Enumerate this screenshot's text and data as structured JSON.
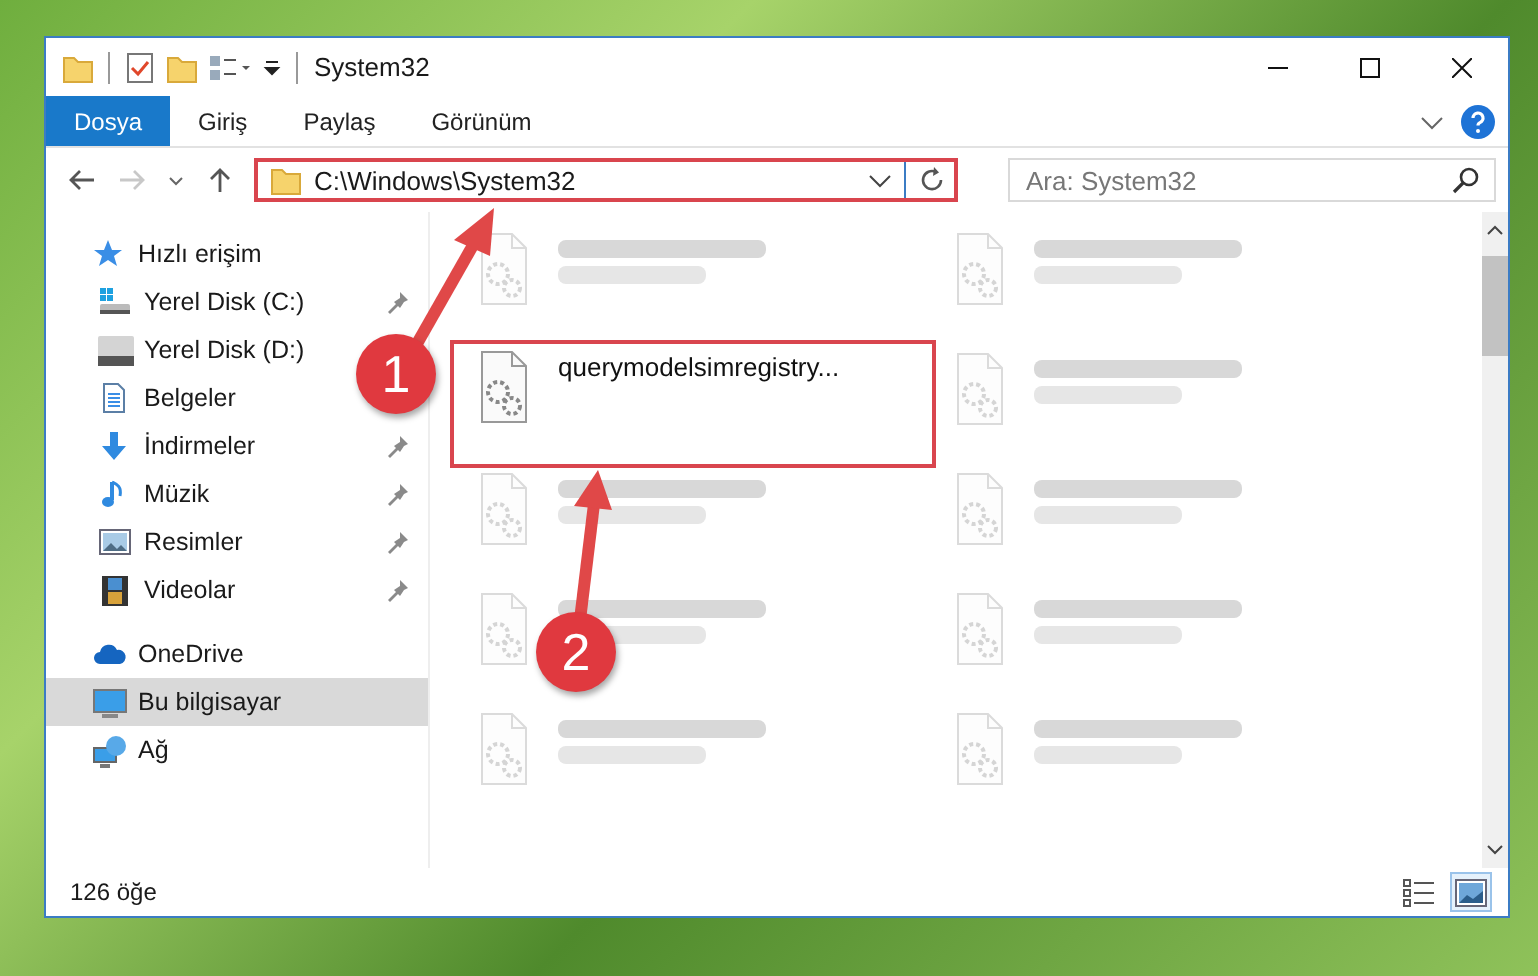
{
  "window": {
    "title": "System32"
  },
  "ribbon_tabs": [
    {
      "label": "Dosya",
      "selected": true
    },
    {
      "label": "Giriş",
      "selected": false
    },
    {
      "label": "Paylaş",
      "selected": false
    },
    {
      "label": "Görünüm",
      "selected": false
    }
  ],
  "nav": {
    "back_disabled": false,
    "forward_disabled": true
  },
  "address": {
    "path": "C:\\Windows\\System32"
  },
  "search": {
    "placeholder": "Ara: System32"
  },
  "sidebar": {
    "items": [
      {
        "label": "Hızlı erişim",
        "kind": "star",
        "selected": false,
        "children": [
          {
            "label": "Yerel Disk (C:)",
            "kind": "drive-win",
            "pinned": true
          },
          {
            "label": "Yerel Disk (D:)",
            "kind": "drive",
            "pinned": false
          },
          {
            "label": "Belgeler",
            "kind": "doc",
            "pinned": false
          },
          {
            "label": "İndirmeler",
            "kind": "download",
            "pinned": true
          },
          {
            "label": "Müzik",
            "kind": "music",
            "pinned": true
          },
          {
            "label": "Resimler",
            "kind": "picture",
            "pinned": true
          },
          {
            "label": "Videolar",
            "kind": "video",
            "pinned": true
          }
        ]
      },
      {
        "label": "OneDrive",
        "kind": "cloud",
        "selected": false
      },
      {
        "label": "Bu bilgisayar",
        "kind": "pc",
        "selected": true
      },
      {
        "label": "Ağ",
        "kind": "network",
        "selected": false
      }
    ]
  },
  "files": [
    {
      "blurred": true
    },
    {
      "blurred": true
    },
    {
      "name": "querymodelsimregistry...",
      "blurred": false
    },
    {
      "blurred": true
    },
    {
      "blurred": true
    },
    {
      "blurred": true
    },
    {
      "blurred": true
    },
    {
      "blurred": true
    },
    {
      "blurred": true
    },
    {
      "blurred": true
    }
  ],
  "status_bar": {
    "count": "126 öğe"
  },
  "view_buttons": [
    {
      "kind": "details",
      "selected": false
    },
    {
      "kind": "large-icons",
      "selected": true
    }
  ],
  "annotations": [
    {
      "label": "1"
    },
    {
      "label": "2"
    }
  ]
}
